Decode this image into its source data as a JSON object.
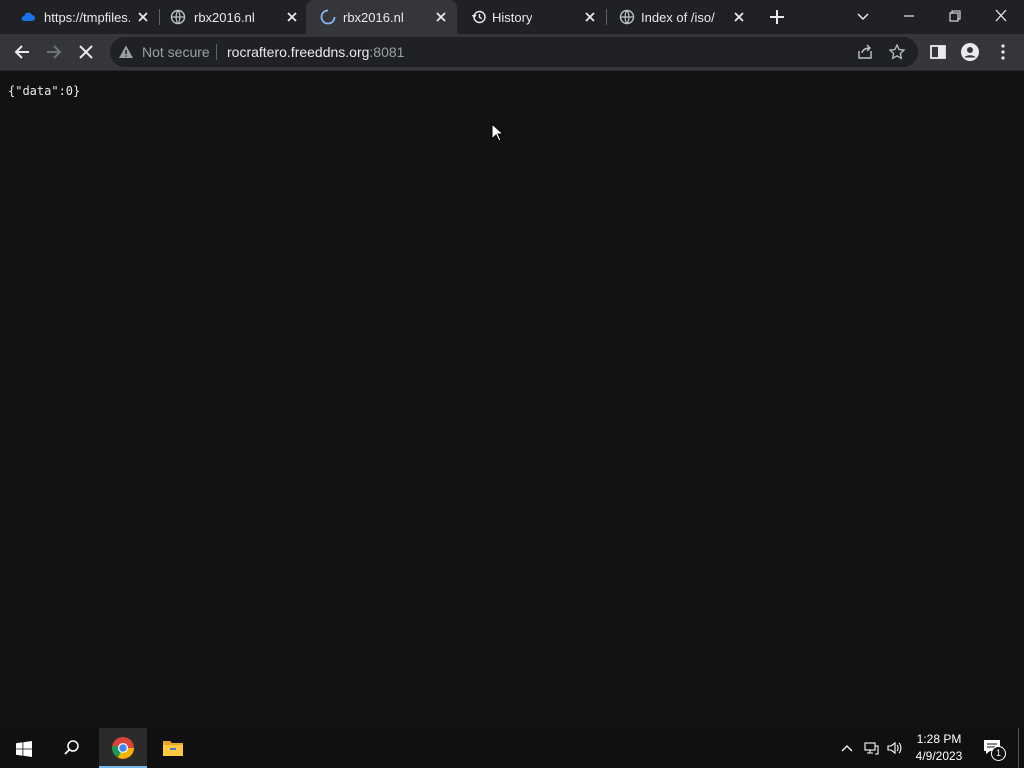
{
  "tabs": [
    {
      "title": "https://tmpfiles.",
      "icon": "cloud-icon",
      "active": false
    },
    {
      "title": "rbx2016.nl",
      "icon": "globe-icon",
      "active": false
    },
    {
      "title": "rbx2016.nl",
      "icon": "loading-spinner-icon",
      "active": true
    },
    {
      "title": "History",
      "icon": "history-icon",
      "active": false
    },
    {
      "title": "Index of /iso/",
      "icon": "globe-icon",
      "active": false
    }
  ],
  "toolbar": {
    "security_label": "Not secure",
    "url_host": "rocraftero.freeddns.org",
    "url_port": ":8081"
  },
  "page": {
    "body_text": "{\"data\":0}"
  },
  "taskbar": {
    "time": "1:28 PM",
    "date": "4/9/2023",
    "notification_count": "1"
  },
  "colors": {
    "accent": "#8ab4f8",
    "page_background": "#121212",
    "toolbar": "#35363a",
    "tabstrip": "#202124"
  }
}
